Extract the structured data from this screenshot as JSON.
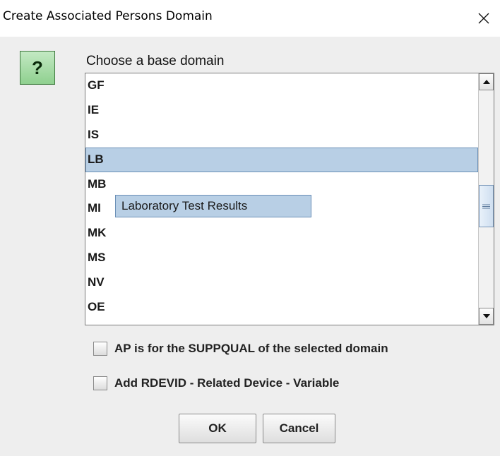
{
  "window": {
    "title": "Create Associated Persons Domain",
    "close_icon": "close-icon"
  },
  "dialog": {
    "icon": "question-icon",
    "icon_glyph": "?",
    "prompt": "Choose a base domain"
  },
  "domain_list": {
    "items": [
      "GF",
      "IE",
      "IS",
      "LB",
      "MB",
      "MI",
      "MK",
      "MS",
      "NV",
      "OE"
    ],
    "selected": "LB",
    "tooltip": "Laboratory Test Results",
    "scroll_position": 0.5
  },
  "options": {
    "suppqual_label": "AP is for the SUPPQUAL of the selected domain",
    "suppqual_checked": false,
    "rdevid_label": "Add RDEVID - Related Device - Variable",
    "rdevid_checked": false
  },
  "buttons": {
    "ok_label": "OK",
    "cancel_label": "Cancel"
  },
  "colors": {
    "selection": "#b8cfe5",
    "selection_border": "#6a8fb6",
    "icon_green": "#8fd08f"
  }
}
